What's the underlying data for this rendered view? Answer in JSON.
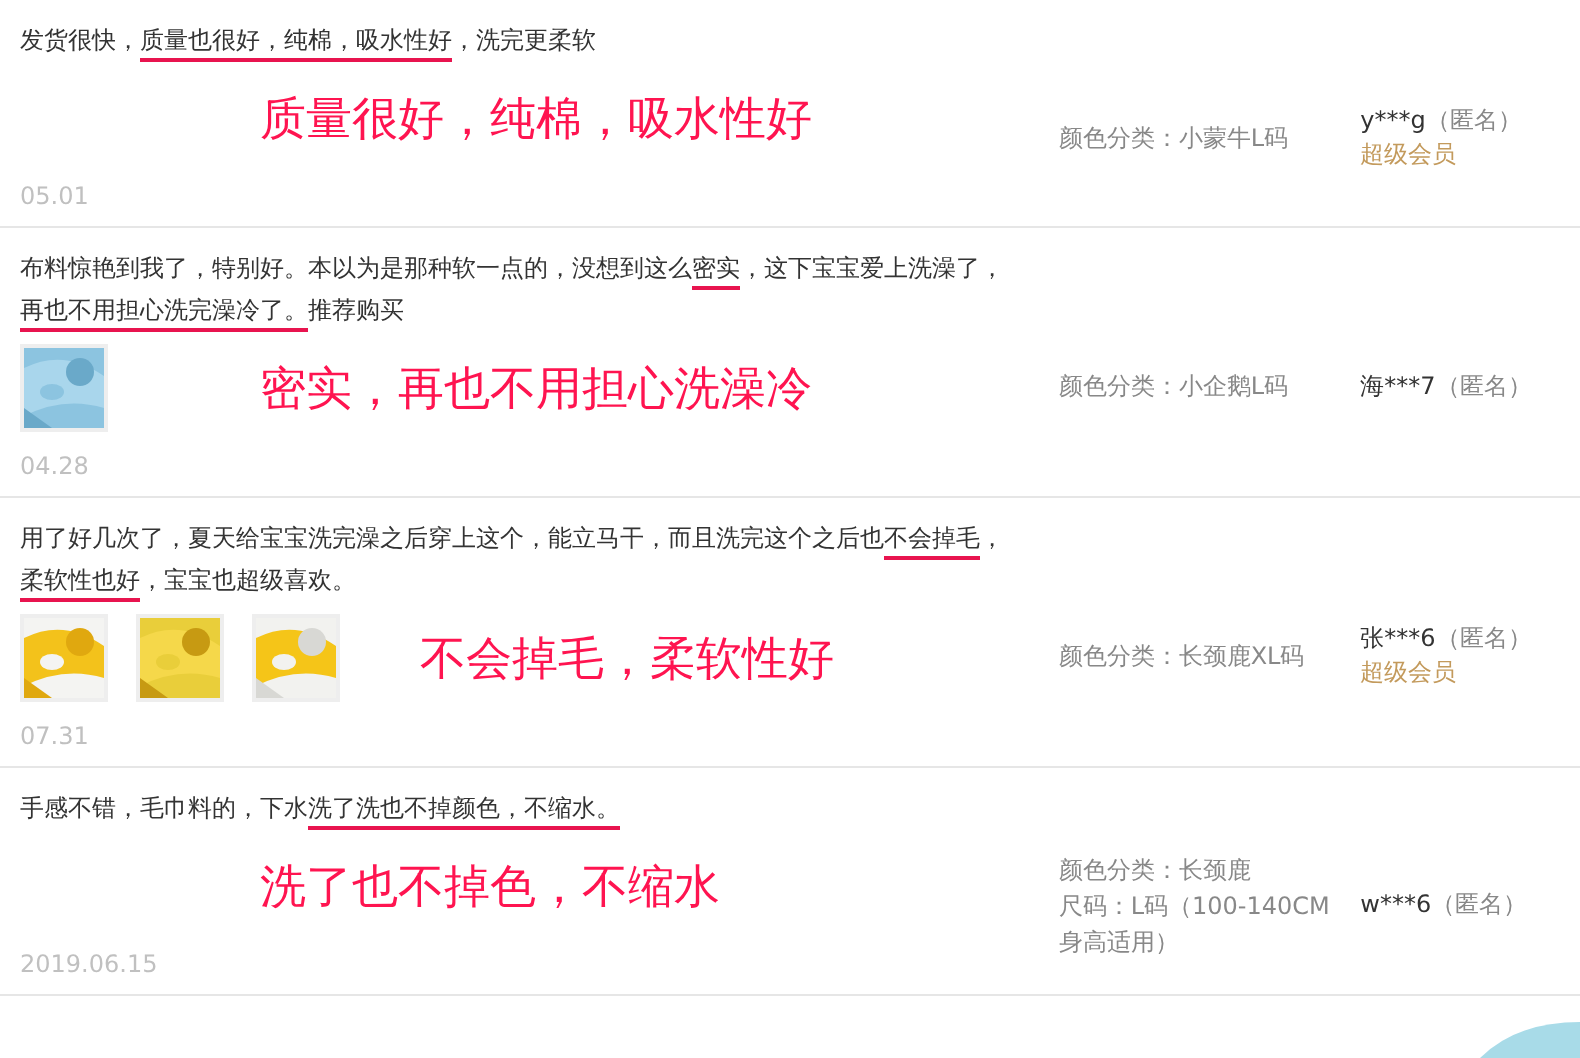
{
  "reviews": [
    {
      "text": [
        {
          "text": "发货很快，",
          "underlined": false
        },
        {
          "text": "质量也很好，纯棉，吸水性好",
          "underlined": true
        },
        {
          "text": "，洗完更柔软",
          "underlined": false
        }
      ],
      "callout": "质量很好，纯棉，吸水性好",
      "attributes": [
        "颜色分类：小蒙牛L码"
      ],
      "user": "y***g",
      "anonymous": "（匿名）",
      "member": "超级会员",
      "date": "05.01"
    },
    {
      "text": [
        {
          "text": "布料惊艳到我了，特别好。本以为是那种软一点的，没想到这么",
          "underlined": false
        },
        {
          "text": "密实",
          "underlined": true
        },
        {
          "text": "，这下宝宝爱上洗澡了，",
          "underlined": false
        },
        {
          "text": "再也不用担心洗完澡冷了。",
          "underlined": true
        },
        {
          "text": "推荐购买",
          "underlined": false
        }
      ],
      "callout": "密实，再也不用担心洗澡冷",
      "photos": [
        {
          "kind": "picture"
        }
      ],
      "attributes": [
        "颜色分类：小企鹅L码"
      ],
      "user": "海***7",
      "anonymous": "（匿名）",
      "date": "04.28"
    },
    {
      "text": [
        {
          "text": "用了好几次了，夏天给宝宝洗完澡之后穿上这个，能立马干，而且洗完这个之后也",
          "underlined": false
        },
        {
          "text": "不会掉毛",
          "underlined": true
        },
        {
          "text": "，",
          "underlined": false
        },
        {
          "text": "柔软性也好",
          "underlined": true
        },
        {
          "text": "，宝宝也超级喜欢。",
          "underlined": false
        }
      ],
      "callout": "不会掉毛，柔软性好",
      "photos": [
        {
          "kind": "picture"
        },
        {
          "kind": "picture"
        },
        {
          "kind": "picture"
        }
      ],
      "attributes": [
        "颜色分类：长颈鹿XL码"
      ],
      "user": "张***6",
      "anonymous": "（匿名）",
      "member": "超级会员",
      "date": "07.31"
    },
    {
      "text": [
        {
          "text": "手感不错，毛巾料的，下水",
          "underlined": false
        },
        {
          "text": "洗了洗也不掉颜色，不缩水。",
          "underlined": true
        }
      ],
      "callout": "洗了也不掉色，不缩水",
      "attributes": [
        "颜色分类：长颈鹿",
        "尺码：L码（100-140CM 身高适用）"
      ],
      "user": "w***6",
      "anonymous": "（匿名）",
      "date": "2019.06.15"
    }
  ]
}
